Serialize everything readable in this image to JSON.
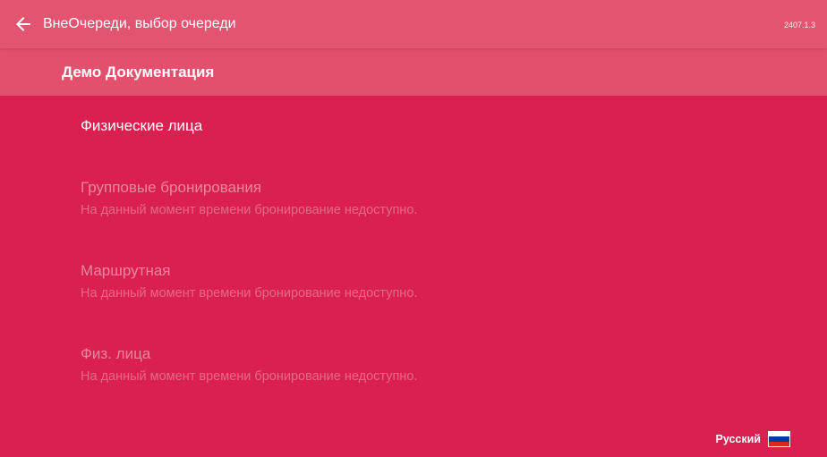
{
  "header": {
    "back_icon": "arrow-left-icon",
    "title": "ВнеОчереди, выбор очереди",
    "version": "2407.1.3"
  },
  "subheader": {
    "title": "Демо Документация"
  },
  "queues": [
    {
      "name": "Физические лица",
      "note": "",
      "available": true
    },
    {
      "name": "Групповые бронирования",
      "note": "На данный момент времени бронирование недоступно.",
      "available": false
    },
    {
      "name": "Маршрутная",
      "note": "На данный момент времени бронирование недоступно.",
      "available": false
    },
    {
      "name": "Физ. лица",
      "note": "На данный момент времени бронирование недоступно.",
      "available": false
    }
  ],
  "language": {
    "label": "Русский",
    "flag_icon": "russian-flag-icon",
    "flag_colors": [
      "#ffffff",
      "#0039a6",
      "#d52b1e"
    ]
  },
  "colors": {
    "background": "#d92050",
    "topbar": "#e25470",
    "subheader": "#e2506d",
    "text": "#ffffff"
  }
}
